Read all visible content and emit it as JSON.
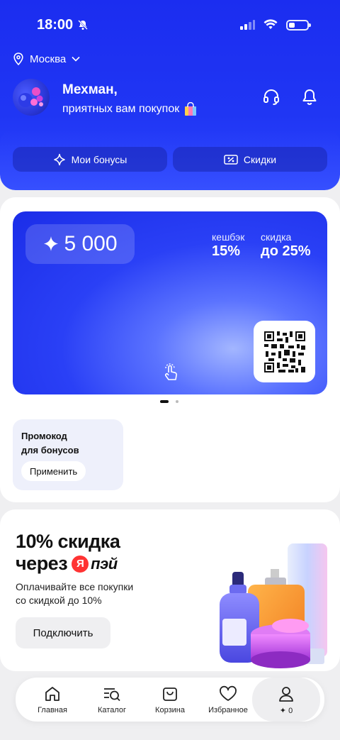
{
  "status_bar": {
    "time": "18:00"
  },
  "header": {
    "city": "Москва",
    "greeting_name": "Мехман,",
    "greeting_sub": "приятных вам покупок",
    "buttons": [
      {
        "label": "Мои бонусы"
      },
      {
        "label": "Скидки"
      }
    ]
  },
  "bonus_card": {
    "balance": "5 000",
    "cashback_label": "кешбэк",
    "cashback_value": "15%",
    "discount_label": "скидка",
    "discount_value": "до 25%"
  },
  "promo": {
    "title_line1": "Промокод",
    "title_line2": "для бонусов",
    "button": "Применить"
  },
  "ad": {
    "title_line1": "10% скидка",
    "title_line2_prefix": "через",
    "logo_letter": "Я",
    "logo_text": "пэй",
    "desc_line1": "Оплачивайте все покупки",
    "desc_line2": "со скидкой до 10%",
    "button": "Подключить"
  },
  "tabbar": {
    "items": [
      {
        "label": "Главная",
        "icon": "home-icon"
      },
      {
        "label": "Каталог",
        "icon": "catalog-search-icon"
      },
      {
        "label": "Корзина",
        "icon": "bag-icon"
      },
      {
        "label": "Избранное",
        "icon": "heart-icon"
      },
      {
        "label": "✦ 0",
        "icon": "profile-icon"
      }
    ]
  },
  "colors": {
    "brand_blue": "#1b2df0",
    "card_bg": "#ffffff",
    "page_bg": "#efeff1"
  }
}
